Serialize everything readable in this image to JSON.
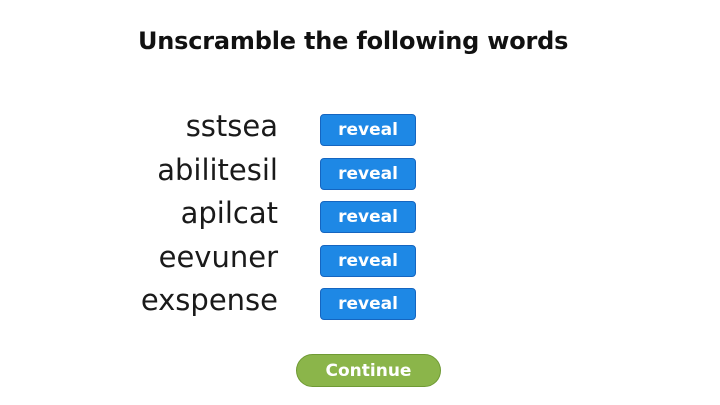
{
  "title": "Unscramble the following words",
  "words": [
    {
      "scrambled": "sstsea",
      "button_label": "reveal"
    },
    {
      "scrambled": "abilitesil",
      "button_label": "reveal"
    },
    {
      "scrambled": "apilcat",
      "button_label": "reveal"
    },
    {
      "scrambled": "eevuner",
      "button_label": "reveal"
    },
    {
      "scrambled": "exspense",
      "button_label": "reveal"
    }
  ],
  "continue_label": "Continue",
  "colors": {
    "reveal_button": "#1e88e5",
    "continue_button": "#8bb54a",
    "text": "#111111"
  }
}
